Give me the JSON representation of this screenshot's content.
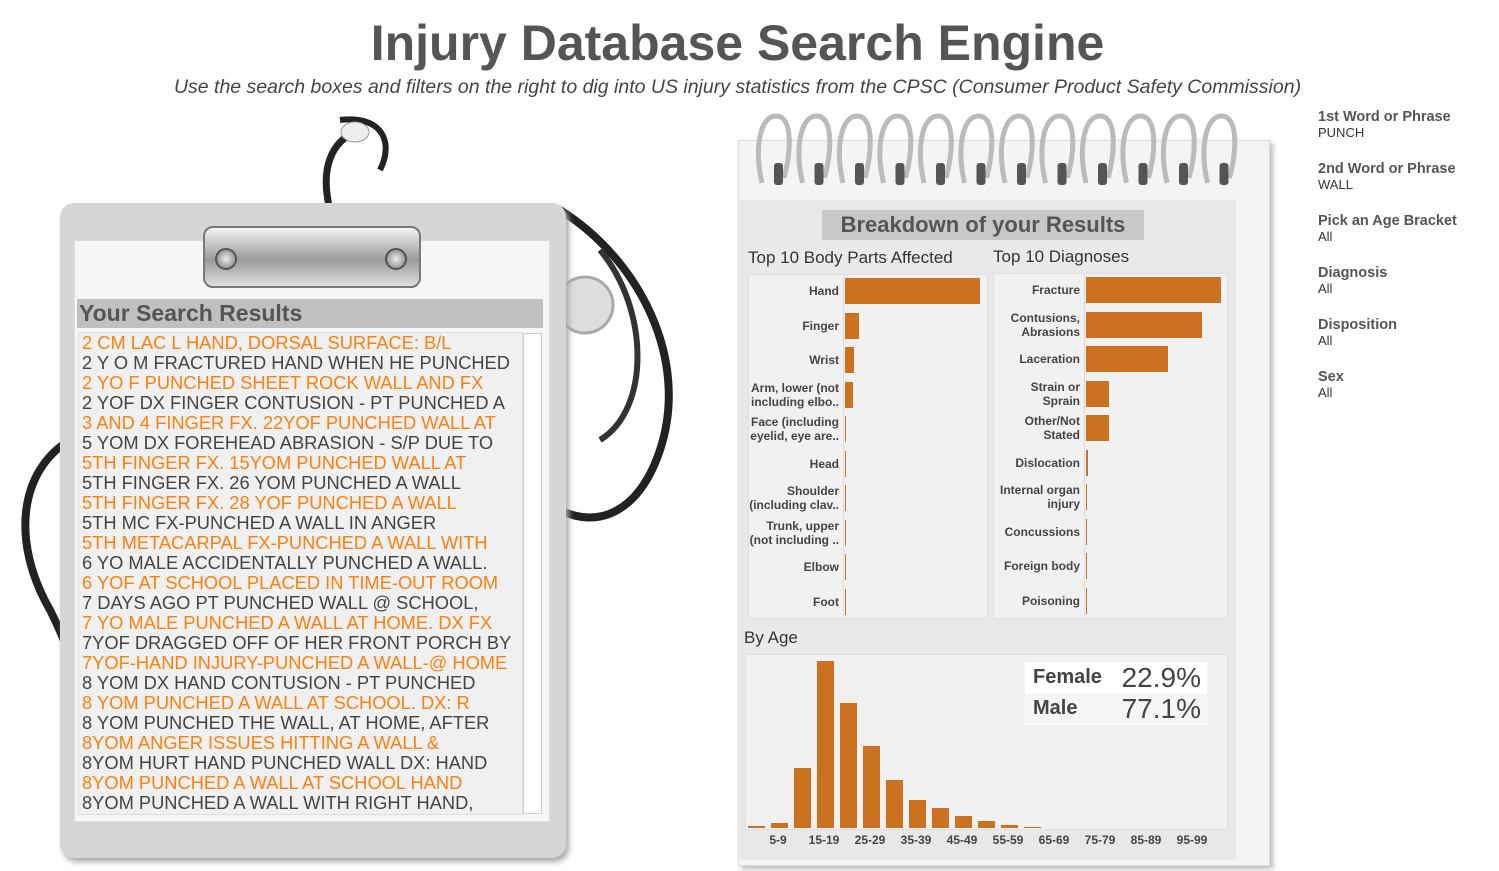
{
  "header": {
    "title": "Injury Database Search Engine",
    "subtitle": "Use the search boxes and filters on the right to dig into US injury statistics from the CPSC (Consumer Product Safety Commission)"
  },
  "results": {
    "title": "Your Search Results",
    "highlight_color": "#ff7f0e",
    "text_color": "#444444",
    "rows": [
      "2 CM LAC L HAND, DORSAL SURFACE: B/L",
      "2 Y O M FRACTURED HAND WHEN HE PUNCHED",
      "2 YO F PUNCHED SHEET ROCK WALL AND FX",
      "2 YOF DX FINGER CONTUSION - PT PUNCHED A",
      "3 AND 4 FINGER FX.  22YOF PUNCHED WALL AT",
      "5 YOM DX FOREHEAD ABRASION - S/P DUE TO",
      "5TH FINGER FX.  15YOM PUNCHED WALL AT",
      "5TH FINGER FX. 26 YOM PUNCHED A WALL",
      "5TH FINGER FX. 28 YOF PUNCHED A WALL",
      "5TH MC FX-PUNCHED A WALL IN ANGER",
      "5TH METACARPAL FX-PUNCHED A WALL WITH",
      "6 YO MALE ACCIDENTALLY PUNCHED A WALL.",
      "6 YOF AT SCHOOL PLACED IN TIME-OUT ROOM",
      "7 DAYS AGO PT PUNCHED WALL @ SCHOOL,",
      "7 YO MALE PUNCHED A WALL AT HOME.  DX FX",
      "7YOF DRAGGED OFF OF HER FRONT PORCH BY",
      "7YOF-HAND INJURY-PUNCHED A WALL-@ HOME",
      "8 YOM DX HAND CONTUSION - PT PUNCHED",
      "8 YOM PUNCHED A WALL AT SCHOOL. DX:  R",
      "8 YOM PUNCHED THE WALL, AT HOME, AFTER",
      "8YOM ANGER ISSUES HITTING A WALL &",
      "8YOM HURT HAND PUNCHED WALL DX: HAND",
      "8YOM PUNCHED A WALL AT SCHOOL HAND",
      "8YOM PUNCHED A WALL WITH RIGHT HAND,"
    ]
  },
  "breakdown": {
    "title": "Breakdown of your Results"
  },
  "filters": [
    {
      "label": "1st Word or Phrase",
      "value": "PUNCH"
    },
    {
      "label": "2nd Word or Phrase",
      "value": "WALL"
    },
    {
      "label": "Pick an Age Bracket",
      "value": "All"
    },
    {
      "label": "Diagnosis",
      "value": "All"
    },
    {
      "label": "Disposition",
      "value": "All"
    },
    {
      "label": "Sex",
      "value": "All"
    }
  ],
  "chart_data": [
    {
      "type": "bar",
      "orientation": "horizontal",
      "title": "Top 10 Body Parts Affected",
      "color": "#cc711f",
      "categories": [
        "Hand",
        "Finger",
        "Wrist",
        "Arm, lower (not including elbo..",
        "Face (including eyelid, eye are..",
        "Head",
        "Shoulder (including clav..",
        "Trunk, upper (not including ..",
        "Elbow",
        "Foot"
      ],
      "values": [
        100,
        10,
        7,
        6,
        0.3,
        0.2,
        0.2,
        0.1,
        0.1,
        0.1
      ]
    },
    {
      "type": "bar",
      "orientation": "horizontal",
      "title": "Top 10 Diagnoses",
      "color": "#cc711f",
      "categories": [
        "Fracture",
        "Contusions, Abrasions",
        "Laceration",
        "Strain or Sprain",
        "Other/Not Stated",
        "Dislocation",
        "Internal organ injury",
        "Concussions",
        "Foreign body",
        "Poisoning"
      ],
      "values": [
        100,
        86,
        61,
        17,
        17,
        1.5,
        0.6,
        0.1,
        0.1,
        0.1
      ]
    },
    {
      "type": "bar",
      "title": "By Age",
      "color": "#cc711f",
      "categories": [
        "0-4",
        "5-9",
        "10-14",
        "15-19",
        "20-24",
        "25-29",
        "30-34",
        "35-39",
        "40-44",
        "45-49",
        "50-54",
        "55-59",
        "60-64",
        "65-69",
        "70-74",
        "75-79",
        "80-84",
        "85-89",
        "90-94",
        "95-99"
      ],
      "tick_labels": [
        "5-9",
        "15-19",
        "25-29",
        "35-39",
        "45-49",
        "55-59",
        "65-69",
        "75-79",
        "85-89",
        "95-99"
      ],
      "values": [
        1,
        3,
        36,
        100,
        75,
        49,
        29,
        17,
        12,
        7,
        4,
        2,
        0.6,
        0,
        0,
        0,
        0,
        0,
        0,
        0
      ],
      "legend": [
        {
          "name": "Female",
          "value": "22.9%"
        },
        {
          "name": "Male",
          "value": "77.1%"
        }
      ]
    }
  ]
}
